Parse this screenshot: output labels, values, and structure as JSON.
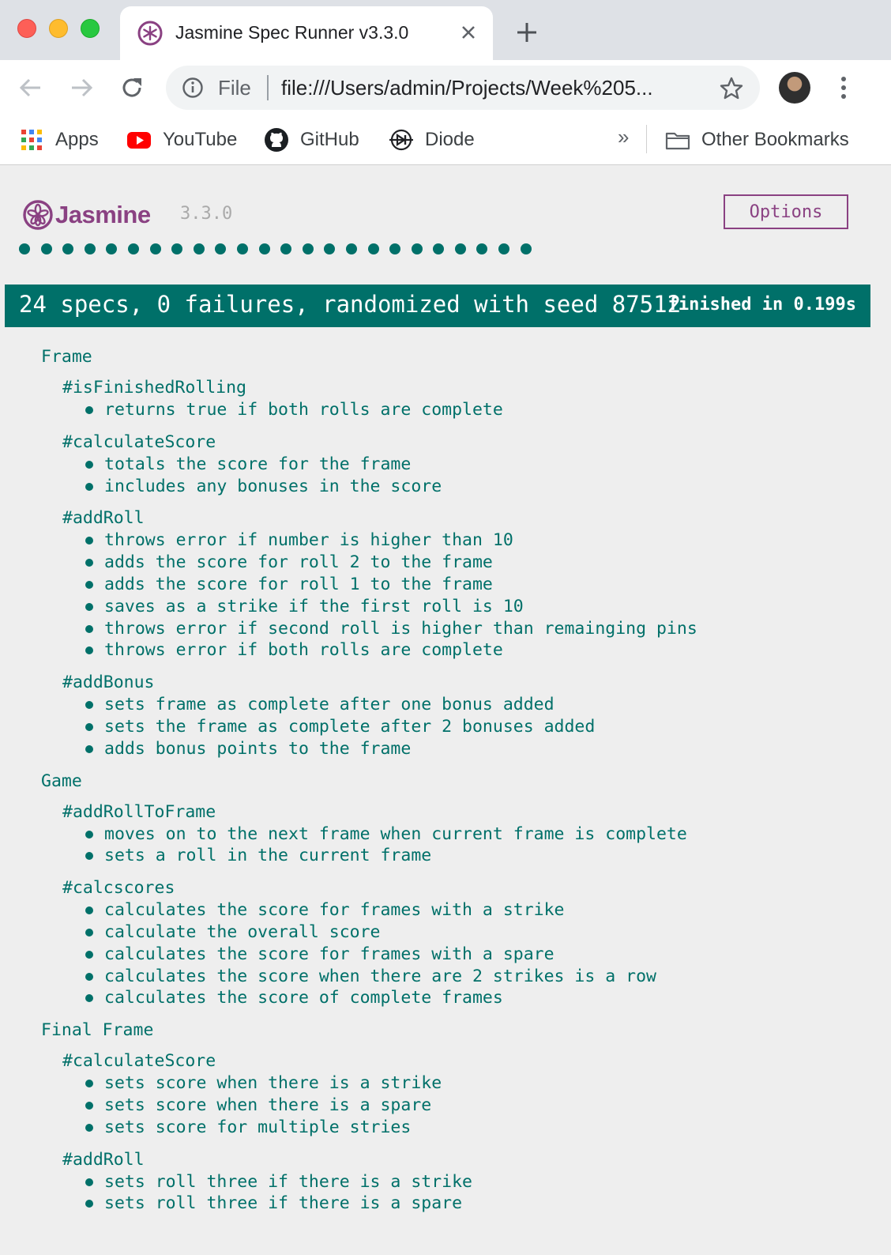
{
  "colors": {
    "jasmine_purple": "#8a4182",
    "pass_green": "#007069",
    "page_bg": "#eeeeee"
  },
  "browser": {
    "tab": {
      "title": "Jasmine Spec Runner v3.3.0",
      "favicon": "jasmine-favicon",
      "close_icon": "close-icon"
    },
    "new_tab_icon": "plus-icon",
    "toolbar": {
      "back_icon": "back-arrow-icon",
      "forward_icon": "forward-arrow-icon",
      "reload_icon": "reload-icon",
      "info_icon": "info-icon",
      "scheme_label": "File",
      "url": "file:///Users/admin/Projects/Week%205...",
      "bookmark_star_icon": "star-icon",
      "menu_icon": "vertical-dots-icon"
    },
    "bookmarks": {
      "items": [
        {
          "label": "Apps",
          "icon": "apps-grid-icon"
        },
        {
          "label": "YouTube",
          "icon": "youtube-icon"
        },
        {
          "label": "GitHub",
          "icon": "github-icon"
        },
        {
          "label": "Diode",
          "icon": "diode-icon"
        }
      ],
      "overflow": "»",
      "other": {
        "label": "Other Bookmarks",
        "icon": "folder-icon"
      }
    }
  },
  "jasmine": {
    "logo_text": "Jasmine",
    "version": "3.3.0",
    "options_label": "Options",
    "spec_dot_count": 24,
    "summary": "24 specs, 0 failures, randomized with seed 87512",
    "duration": "finished in 0.199s",
    "suites": [
      {
        "name": "Frame",
        "groups": [
          {
            "name": "#isFinishedRolling",
            "specs": [
              "returns true if both rolls are complete"
            ]
          },
          {
            "name": "#calculateScore",
            "specs": [
              "totals the score for the frame",
              "includes any bonuses in the score"
            ]
          },
          {
            "name": "#addRoll",
            "specs": [
              "throws error if number is higher than 10",
              "adds the score for roll 2 to the frame",
              "adds the score for roll 1 to the frame",
              "saves as a strike if the first roll is 10",
              "throws error if second roll is higher than remainging pins",
              "throws error if both rolls are complete"
            ]
          },
          {
            "name": "#addBonus",
            "specs": [
              "sets frame as complete after one bonus added",
              "sets the frame as complete after 2 bonuses added",
              "adds bonus points to the frame"
            ]
          }
        ]
      },
      {
        "name": "Game",
        "groups": [
          {
            "name": "#addRollToFrame",
            "specs": [
              "moves on to the next frame when current frame is complete",
              "sets a roll in the current frame"
            ]
          },
          {
            "name": "#calcscores",
            "specs": [
              "calculates the score for frames with a strike",
              "calculate the overall score",
              "calculates the score for frames with a spare",
              "calculates the score when there are 2 strikes is a row",
              "calculates the score of complete frames"
            ]
          }
        ]
      },
      {
        "name": "Final Frame",
        "groups": [
          {
            "name": "#calculateScore",
            "specs": [
              "sets score when there is a strike",
              "sets score when there is a spare",
              "sets score for multiple stries"
            ]
          },
          {
            "name": "#addRoll",
            "specs": [
              "sets roll three if there is a strike",
              "sets roll three if there is a spare"
            ]
          }
        ]
      }
    ]
  }
}
